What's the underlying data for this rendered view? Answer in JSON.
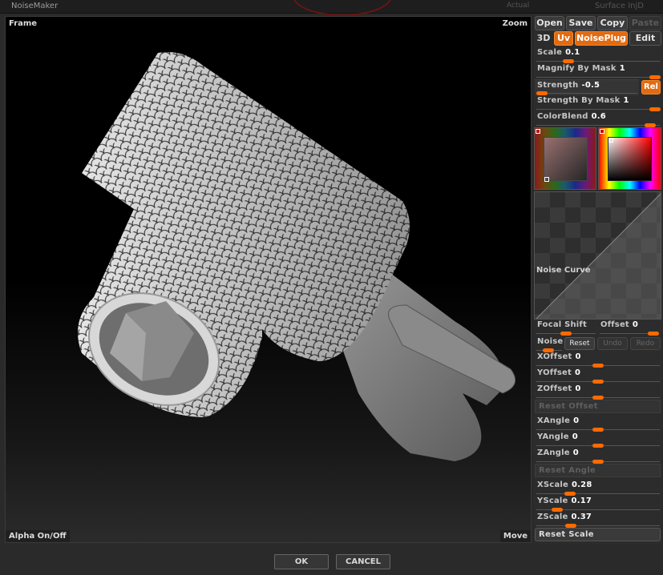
{
  "window": {
    "title": "NoiseMaker",
    "bg_ghost_right": "Surface InjD",
    "bg_ghost_actual": "Actual"
  },
  "viewport": {
    "frame_label": "Frame",
    "zoom_label": "Zoom",
    "alpha_label": "Alpha On/Off",
    "move_label": "Move"
  },
  "toolbar": {
    "open": "Open",
    "save": "Save",
    "copy": "Copy",
    "paste": "Paste"
  },
  "tabs": {
    "t3d": "3D",
    "uv": "Uv",
    "noiseplug": "NoisePlug",
    "edit": "Edit"
  },
  "params": {
    "scale": {
      "label": "Scale",
      "value": "0.1"
    },
    "magnify": {
      "label": "Magnify By Mask",
      "value": "1"
    },
    "strength": {
      "label": "Strength",
      "value": "-0.5"
    },
    "rel": "Rel",
    "strength_mask": {
      "label": "Strength By Mask",
      "value": "1"
    },
    "colorblend": {
      "label": "ColorBlend",
      "value": "0.6"
    }
  },
  "curve": {
    "label": "Noise Curve"
  },
  "focal": {
    "label": "Focal Shift",
    "value": ""
  },
  "offset": {
    "label": "Offset",
    "value": "0"
  },
  "noise_row": {
    "noise": "Noise",
    "reset": "Reset",
    "undo": "Undo",
    "redo": "Redo"
  },
  "offsets": {
    "x": {
      "label": "XOffset",
      "value": "0"
    },
    "y": {
      "label": "YOffset",
      "value": "0"
    },
    "z": {
      "label": "ZOffset",
      "value": "0"
    },
    "reset": "Reset Offset"
  },
  "angles": {
    "x": {
      "label": "XAngle",
      "value": "0"
    },
    "y": {
      "label": "YAngle",
      "value": "0"
    },
    "z": {
      "label": "ZAngle",
      "value": "0"
    },
    "reset": "Reset Angle"
  },
  "scales": {
    "x": {
      "label": "XScale",
      "value": "0.28"
    },
    "y": {
      "label": "YScale",
      "value": "0.17"
    },
    "z": {
      "label": "ZScale",
      "value": "0.37"
    },
    "reset": "Reset Scale"
  },
  "dialog": {
    "ok": "OK",
    "cancel": "CANCEL"
  },
  "colors": {
    "accent": "#ff6a00",
    "panel_bg": "#2c2c2c",
    "viewport_bg": "#000000"
  }
}
